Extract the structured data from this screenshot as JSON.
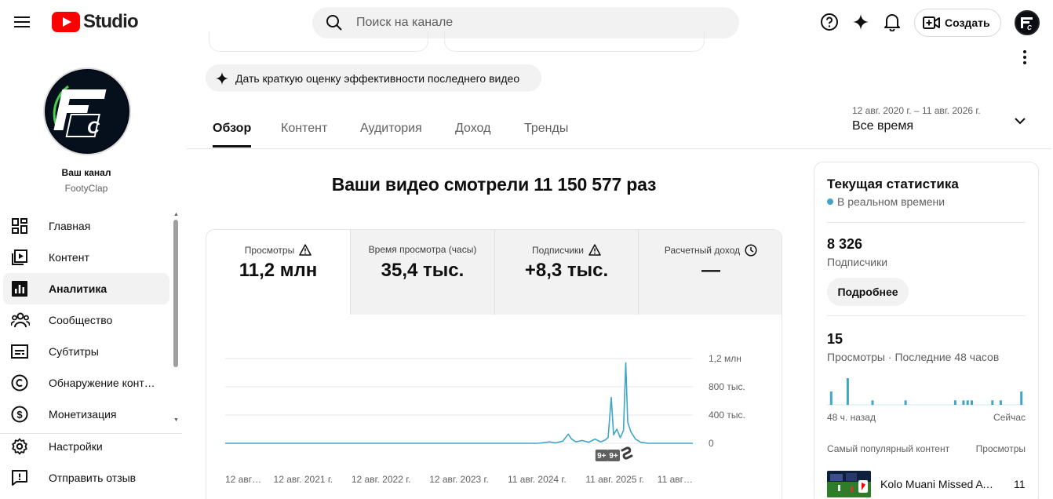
{
  "header": {
    "logo_text": "Studio",
    "search_placeholder": "Поиск на канале",
    "create_label": "Создать"
  },
  "sidebar": {
    "channel_label": "Ваш канал",
    "channel_name": "FootyClap",
    "items": [
      {
        "label": "Главная",
        "icon": "dashboard-icon"
      },
      {
        "label": "Контент",
        "icon": "content-icon"
      },
      {
        "label": "Аналитика",
        "icon": "analytics-icon",
        "active": true
      },
      {
        "label": "Сообщество",
        "icon": "community-icon"
      },
      {
        "label": "Субтитры",
        "icon": "subtitles-icon"
      },
      {
        "label": "Обнаружение контен…",
        "icon": "copyright-icon"
      },
      {
        "label": "Монетизация",
        "icon": "monetization-icon"
      }
    ],
    "bottom_items": [
      {
        "label": "Настройки",
        "icon": "gear-icon"
      },
      {
        "label": "Отправить отзыв",
        "icon": "feedback-icon"
      }
    ]
  },
  "main": {
    "suggestion_chip": "Дать краткую оценку эффективности последнего видео",
    "tabs": [
      "Обзор",
      "Контент",
      "Аудитория",
      "Доход",
      "Тренды"
    ],
    "active_tab": "Обзор",
    "date_range": {
      "range": "12 авг. 2020 г. – 11 авг. 2026 г.",
      "label": "Все время"
    },
    "headline": "Ваши видео смотрели 11 150 577 раз",
    "metrics": [
      {
        "label": "Просмотры",
        "value": "11,2 млн",
        "icon": "warning-icon",
        "selected": true
      },
      {
        "label": "Время просмотра (часы)",
        "value": "35,4 тыс.",
        "icon": "",
        "selected": false
      },
      {
        "label": "Подписчики",
        "value": "+8,3 тыс.",
        "icon": "warning-icon",
        "selected": false
      },
      {
        "label": "Расчетный доход",
        "value": "—",
        "icon": "clock-icon",
        "selected": false
      }
    ]
  },
  "chart_data": {
    "type": "line",
    "y_tick_labels": [
      "1,2 млн",
      "800 тыс.",
      "400 тыс.",
      "0"
    ],
    "y_ticks": [
      1200000,
      800000,
      400000,
      0
    ],
    "ylim": [
      0,
      1200000
    ],
    "x_tick_labels": [
      "12 авг…",
      "12 авг. 2021 г.",
      "12 авг. 2022 г.",
      "12 авг. 2023 г.",
      "11 авг. 2024 г.",
      "11 авг. 2025 г.",
      "11 авг…"
    ],
    "x_ticks": [
      "2020-08-12",
      "2021-08-12",
      "2022-08-12",
      "2023-08-12",
      "2024-08-11",
      "2025-08-11",
      "2026-08-11"
    ],
    "color": "#3ea6c9",
    "series": [
      {
        "points": [
          [
            "2020-08-12",
            0
          ],
          [
            "2024-08-11",
            0
          ],
          [
            "2024-09-01",
            5000
          ],
          [
            "2024-10-10",
            20000
          ],
          [
            "2024-11-05",
            5000
          ],
          [
            "2024-12-10",
            30000
          ],
          [
            "2025-01-05",
            130000
          ],
          [
            "2025-01-20",
            60000
          ],
          [
            "2025-02-10",
            20000
          ],
          [
            "2025-03-10",
            40000
          ],
          [
            "2025-04-10",
            15000
          ],
          [
            "2025-05-10",
            60000
          ],
          [
            "2025-06-05",
            20000
          ],
          [
            "2025-06-25",
            45000
          ],
          [
            "2025-07-10",
            80000
          ],
          [
            "2025-07-25",
            650000
          ],
          [
            "2025-08-05",
            120000
          ],
          [
            "2025-08-20",
            200000
          ],
          [
            "2025-09-05",
            80000
          ],
          [
            "2025-09-20",
            180000
          ],
          [
            "2025-10-01",
            1140000
          ],
          [
            "2025-10-10",
            300000
          ],
          [
            "2025-10-25",
            160000
          ],
          [
            "2025-11-15",
            60000
          ],
          [
            "2025-12-10",
            15000
          ],
          [
            "2026-01-15",
            0
          ],
          [
            "2026-08-11",
            0
          ]
        ]
      }
    ],
    "markers": [
      {
        "text": "9+",
        "date": "2025-06-10"
      },
      {
        "text": "9+",
        "date": "2025-08-05"
      },
      {
        "text": "shorts-icon",
        "date": "2025-09-25"
      }
    ]
  },
  "right_panel": {
    "title": "Текущая статистика",
    "live_label": "В реальном времени",
    "subscribers_value": "8 326",
    "subscribers_label": "Подписчики",
    "details_button": "Подробнее",
    "views_value": "15",
    "views_label": "Просмотры · Последние 48 часов",
    "mini_chart": {
      "type": "bar",
      "hours_ago": [
        47,
        43,
        37,
        29,
        17,
        15,
        14,
        13,
        8,
        6,
        1
      ],
      "values": [
        3,
        6,
        1,
        1,
        1,
        1,
        1,
        1,
        1,
        1,
        3
      ],
      "ymax": 6
    },
    "axis_left": "48 ч. назад",
    "axis_right": "Сейчас",
    "top_content_label": "Самый популярный контент",
    "top_content_views_label": "Просмотры",
    "top_video_title": "Kolo Muani Missed A …",
    "top_video_views": "11"
  },
  "colors": {
    "brand_red": "#ff0000",
    "accent": "#3ea6c9",
    "chip_bg": "#f2f2f2"
  }
}
